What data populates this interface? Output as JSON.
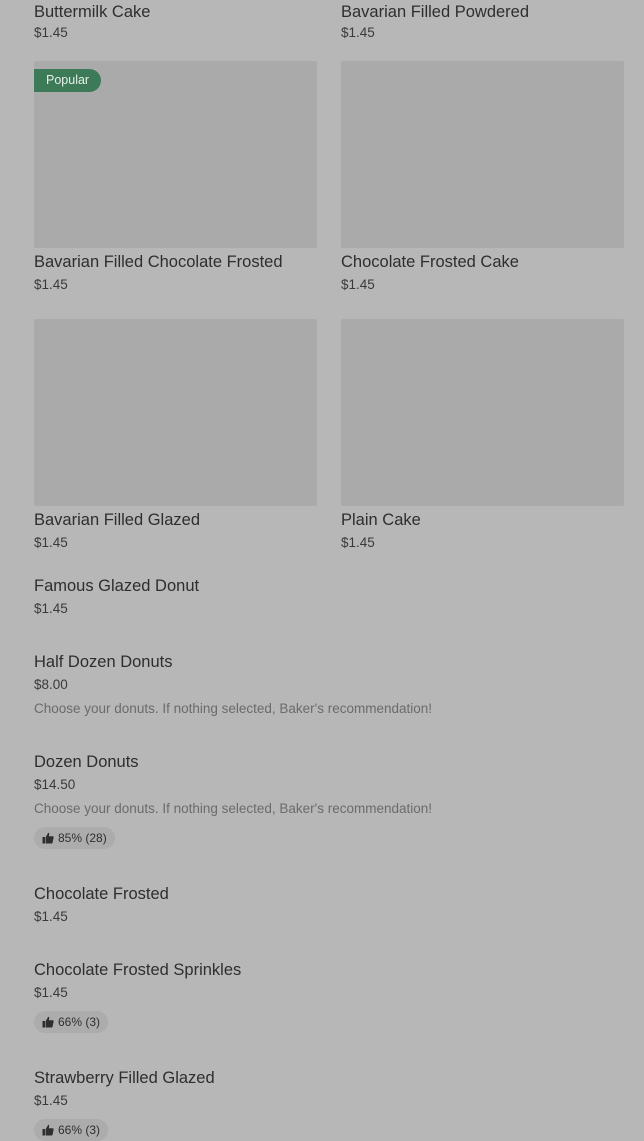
{
  "grid_items": [
    {
      "name": "Buttermilk Cake",
      "price": "$1.45"
    },
    {
      "name": "Bavarian Filled Powdered",
      "price": "$1.45"
    },
    {
      "name": "Bavarian Filled Chocolate Frosted",
      "price": "$1.45",
      "badge": "Popular"
    },
    {
      "name": "Chocolate Frosted Cake",
      "price": "$1.45"
    },
    {
      "name": "Bavarian Filled Glazed",
      "price": "$1.45"
    },
    {
      "name": "Plain Cake",
      "price": "$1.45"
    }
  ],
  "list_items": [
    {
      "name": "Famous Glazed Donut",
      "price": "$1.45"
    },
    {
      "name": "Half Dozen Donuts",
      "price": "$8.00",
      "description": "Choose your donuts. If nothing selected, Baker's recommendation!"
    },
    {
      "name": "Dozen Donuts",
      "price": "$14.50",
      "description": "Choose your donuts. If nothing selected, Baker's recommendation!",
      "rating": "85% (28)"
    },
    {
      "name": "Chocolate Frosted",
      "price": "$1.45"
    },
    {
      "name": "Chocolate Frosted Sprinkles",
      "price": "$1.45",
      "rating": "66% (3)"
    },
    {
      "name": "Strawberry Filled Glazed",
      "price": "$1.45",
      "rating": "66% (3)"
    }
  ],
  "icons": {
    "rating": "thumbs-up-icon"
  },
  "colors": {
    "popular_badge": "#3c7a58",
    "background": "#b7b7b7",
    "image_placeholder": "#aaaaaa"
  }
}
